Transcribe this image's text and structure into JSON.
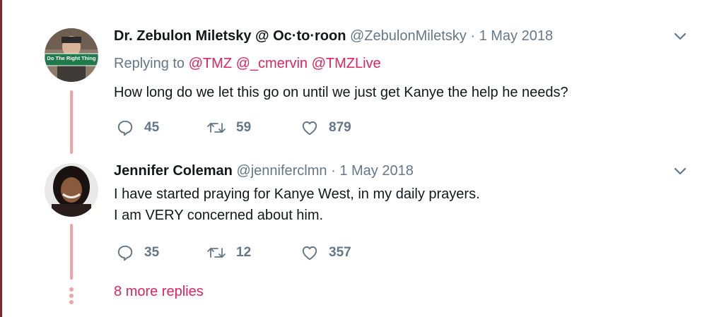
{
  "tweets": [
    {
      "name": "Dr. Zebulon Miletsky @ Oc·to·roon",
      "handle": "@ZebulonMiletsky",
      "separator": "·",
      "date": "1 May 2018",
      "replying_prefix": "Replying to",
      "replying_mentions": [
        "@TMZ",
        "@_cmervin",
        "@TMZLive"
      ],
      "avatar_sign_text": "Do The Right Thing",
      "text_lines": [
        "How long do we let this go on until we just get Kanye the help he needs?"
      ],
      "replies": "45",
      "retweets": "59",
      "likes": "879"
    },
    {
      "name": "Jennifer Coleman",
      "handle": "@jenniferclmn",
      "separator": "·",
      "date": "1 May 2018",
      "text_lines": [
        "I have started praying for Kanye West, in my daily prayers.",
        "I am VERY concerned about him."
      ],
      "replies": "35",
      "retweets": "12",
      "likes": "357"
    }
  ],
  "more_replies": "8 more replies",
  "colors": {
    "accent": "#e0245e",
    "muted": "#657786",
    "thread": "#f2a3a3",
    "text": "#14171a"
  },
  "icons": [
    "reply-icon",
    "retweet-icon",
    "like-icon",
    "chevron-down-icon"
  ]
}
